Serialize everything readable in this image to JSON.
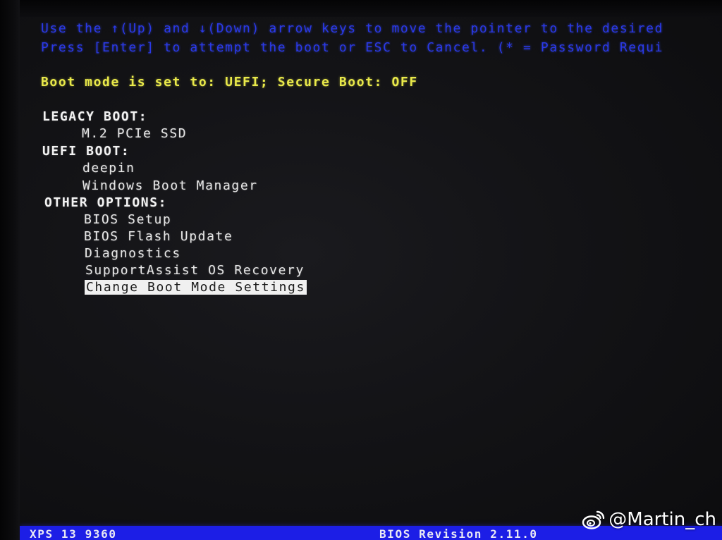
{
  "instructions": {
    "line1": "Use the ↑(Up) and ↓(Down) arrow keys to move the pointer to the desired",
    "line2": "Press [Enter] to attempt the boot or ESC to Cancel. (* = Password Requi"
  },
  "status": {
    "boot_mode": "Boot mode is set to: UEFI; Secure Boot: OFF"
  },
  "menu": {
    "legacy_heading": "LEGACY BOOT:",
    "legacy_items": [
      "M.2 PCIe SSD"
    ],
    "uefi_heading": "UEFI BOOT:",
    "uefi_items": [
      "deepin",
      "Windows Boot Manager"
    ],
    "other_heading": "OTHER OPTIONS:",
    "other_items": [
      "BIOS Setup",
      "BIOS Flash Update",
      "Diagnostics",
      "SupportAssist OS Recovery",
      "Change Boot Mode Settings"
    ],
    "selected": "Change Boot Mode Settings"
  },
  "footer": {
    "model": "XPS 13 9360",
    "bios_revision": "BIOS Revision 2.11.0"
  },
  "watermark": {
    "icon": "weibo-icon",
    "handle": "@Martin_ch"
  },
  "colors": {
    "instructions": "#2a39e8",
    "status": "#e9e94a",
    "footer_bar": "#1c1ee6",
    "selection_bg": "#f0f0f0"
  }
}
